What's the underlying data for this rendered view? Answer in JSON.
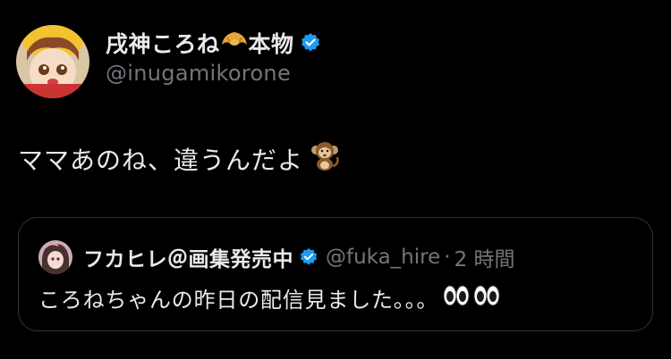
{
  "tweet": {
    "author": {
      "display_name_prefix": "戌神ころね",
      "display_name_emoji": "croissant-emoji",
      "display_name_suffix": "本物",
      "handle": "@inugamikorone",
      "verified": true
    },
    "text": "ママあのね、違うんだよ",
    "text_emoji": "monkey-emoji"
  },
  "quoted_tweet": {
    "author": {
      "display_name": "フカヒレ＠画集発売中",
      "handle": "@fuka_hire",
      "verified": true
    },
    "separator": "·",
    "timestamp": "2 時間",
    "text": "ころねちゃんの昨日の配信見ました。。。",
    "text_emojis": [
      "eyes-emoji",
      "eyes-emoji"
    ]
  },
  "colors": {
    "background": "#000000",
    "primary_text": "#e7e9ea",
    "secondary_text": "#71767b",
    "border": "#2f3336",
    "verified_badge": "#1d9bf0"
  }
}
